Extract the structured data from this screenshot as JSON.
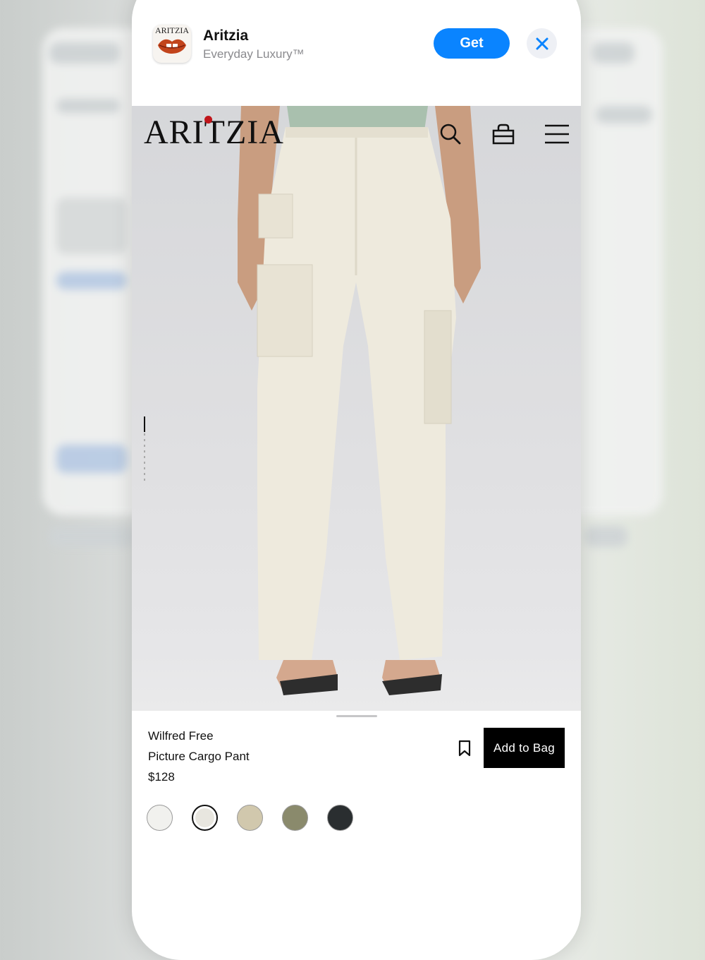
{
  "smart_banner": {
    "app_name": "Aritzia",
    "subtitle": "Everyday Luxury™",
    "get_label": "Get",
    "icon_text": "ARITZIA"
  },
  "site": {
    "logo": "ARITZIA",
    "icons": [
      "search-icon",
      "shopping-bag-icon",
      "menu-icon"
    ]
  },
  "product": {
    "brand": "Wilfred Free",
    "name": "Picture Cargo Pant",
    "price": "$128",
    "add_to_bag_label": "Add to Bag",
    "image_position": {
      "current": 1,
      "total": 6
    },
    "colors": [
      {
        "hex": "#f1f1ee",
        "selected": false
      },
      {
        "hex": "#e8e6df",
        "selected": true
      },
      {
        "hex": "#d1c8ad",
        "selected": false
      },
      {
        "hex": "#8a8a6c",
        "selected": false
      },
      {
        "hex": "#2a2e30",
        "selected": false
      }
    ]
  },
  "colors": {
    "accent": "#0a84ff",
    "button": "#000000",
    "logo_dot": "#c0151a"
  }
}
